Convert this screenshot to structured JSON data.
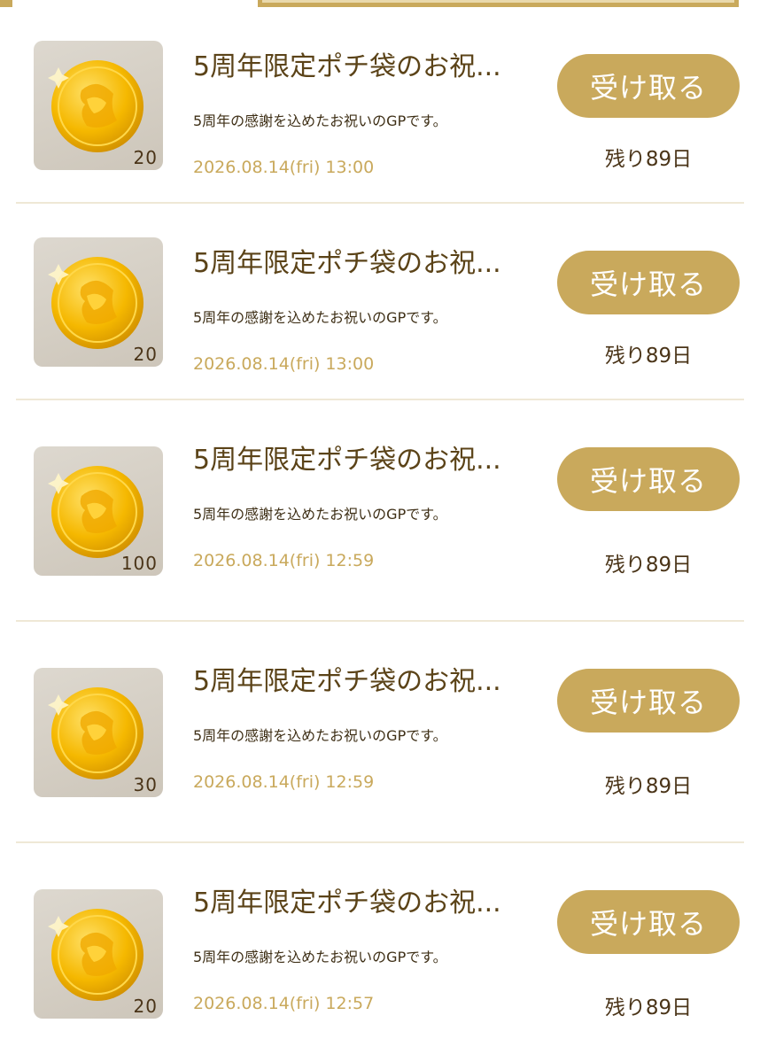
{
  "colors": {
    "accent": "#c9a95c",
    "title": "#5b4318",
    "date": "#c9a95c",
    "divider": "#efe8d6"
  },
  "items": [
    {
      "icon": "gold-coin-icon",
      "quantity": "20",
      "title": "5周年限定ポチ袋のお祝...",
      "description": "5周年の感謝を込めたお祝いのGPです。",
      "date": "2026.08.14(fri) 13:00",
      "button_label": "受け取る",
      "remaining": "残り89日"
    },
    {
      "icon": "gold-coin-icon",
      "quantity": "20",
      "title": "5周年限定ポチ袋のお祝...",
      "description": "5周年の感謝を込めたお祝いのGPです。",
      "date": "2026.08.14(fri) 13:00",
      "button_label": "受け取る",
      "remaining": "残り89日"
    },
    {
      "icon": "gold-coin-icon",
      "quantity": "100",
      "title": "5周年限定ポチ袋のお祝...",
      "description": "5周年の感謝を込めたお祝いのGPです。",
      "date": "2026.08.14(fri) 12:59",
      "button_label": "受け取る",
      "remaining": "残り89日"
    },
    {
      "icon": "gold-coin-icon",
      "quantity": "30",
      "title": "5周年限定ポチ袋のお祝...",
      "description": "5周年の感謝を込めたお祝いのGPです。",
      "date": "2026.08.14(fri) 12:59",
      "button_label": "受け取る",
      "remaining": "残り89日"
    },
    {
      "icon": "gold-coin-icon",
      "quantity": "20",
      "title": "5周年限定ポチ袋のお祝...",
      "description": "5周年の感謝を込めたお祝いのGPです。",
      "date": "2026.08.14(fri) 12:57",
      "button_label": "受け取る",
      "remaining": "残り89日"
    }
  ]
}
